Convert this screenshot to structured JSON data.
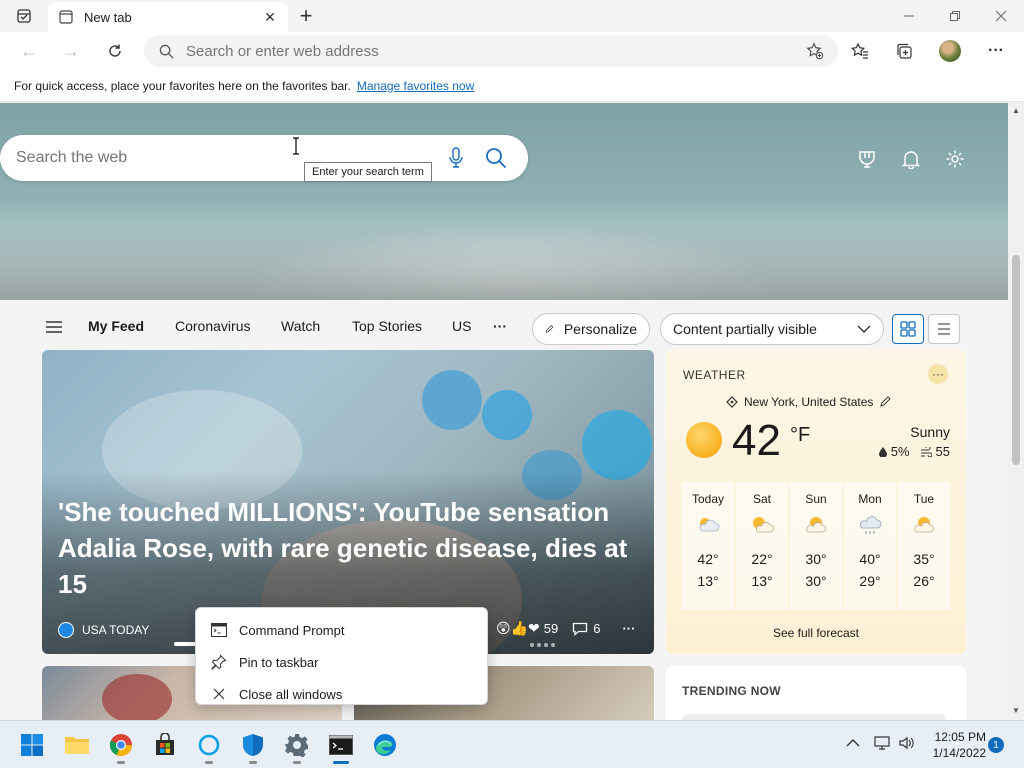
{
  "browser": {
    "tab": {
      "title": "New tab"
    },
    "address_bar": {
      "placeholder": "Search or enter web address"
    },
    "favorites_bar": {
      "message": "For quick access, place your favorites here on the favorites bar.",
      "link": "Manage favorites now"
    }
  },
  "newtab": {
    "search": {
      "placeholder": "Search the web",
      "tooltip": "Enter your search term"
    },
    "feed_nav": {
      "items": [
        "My Feed",
        "Coronavirus",
        "Watch",
        "Top Stories",
        "US"
      ],
      "more": "···",
      "personalize": "Personalize",
      "content_visibility": "Content partially visible"
    },
    "hero_article": {
      "headline": "'She touched MILLIONS': YouTube sensation Adalia Rose, with rare genetic disease, dies at 15",
      "source": "USA TODAY",
      "reactions": "59",
      "comments": "6",
      "more": "···"
    },
    "weather": {
      "label": "WEATHER",
      "more": "···",
      "location": "New York, United States",
      "temperature": "42",
      "unit": "°F",
      "condition": "Sunny",
      "precipitation": "5%",
      "wind": "55",
      "forecast": [
        {
          "day": "Today",
          "high": "42°",
          "low": "13°"
        },
        {
          "day": "Sat",
          "high": "22°",
          "low": "13°"
        },
        {
          "day": "Sun",
          "high": "30°",
          "low": "30°"
        },
        {
          "day": "Mon",
          "high": "40°",
          "low": "29°"
        },
        {
          "day": "Tue",
          "high": "35°",
          "low": "26°"
        }
      ],
      "see_full": "See full forecast"
    },
    "trending": {
      "label": "TRENDING NOW"
    }
  },
  "jump_list": {
    "items": [
      {
        "label": "Command Prompt",
        "icon": "cmd-icon"
      },
      {
        "label": "Pin to taskbar",
        "icon": "pin-icon"
      },
      {
        "label": "Close all windows",
        "icon": "close-icon"
      }
    ]
  },
  "taskbar": {
    "time": "12:05 PM",
    "date": "1/14/2022",
    "notifications": "1"
  },
  "colors": {
    "accent": "#0f6cbd",
    "weather_bg": "#fdf3dc"
  }
}
